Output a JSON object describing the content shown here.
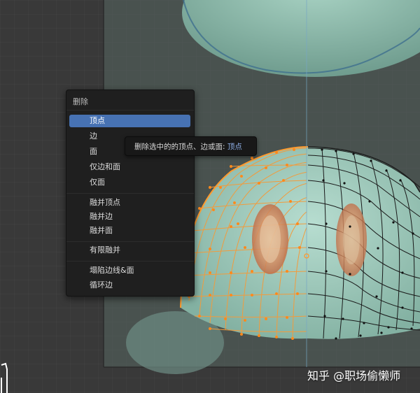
{
  "menu": {
    "title": "删除",
    "items": [
      {
        "label": "顶点",
        "active": true
      },
      {
        "label": "边"
      },
      {
        "label": "面"
      },
      {
        "label": "仅边和面"
      },
      {
        "label": "仅面"
      },
      {
        "label": "融并顶点"
      },
      {
        "label": "融并边"
      },
      {
        "label": "融并面"
      },
      {
        "label": "有限融并"
      },
      {
        "label": "塌陷边线&面"
      },
      {
        "label": "循环边"
      }
    ]
  },
  "tooltip": {
    "text": "删除选中的的顶点、边或面:",
    "value": "顶点"
  },
  "watermark": "知乎 @职场偷懒师",
  "colors": {
    "accent": "#4772b3",
    "selected_vertex": "#ff9a2e",
    "mesh_surface": "#8fbfb0",
    "grid_bg": "#3a3a3a"
  }
}
